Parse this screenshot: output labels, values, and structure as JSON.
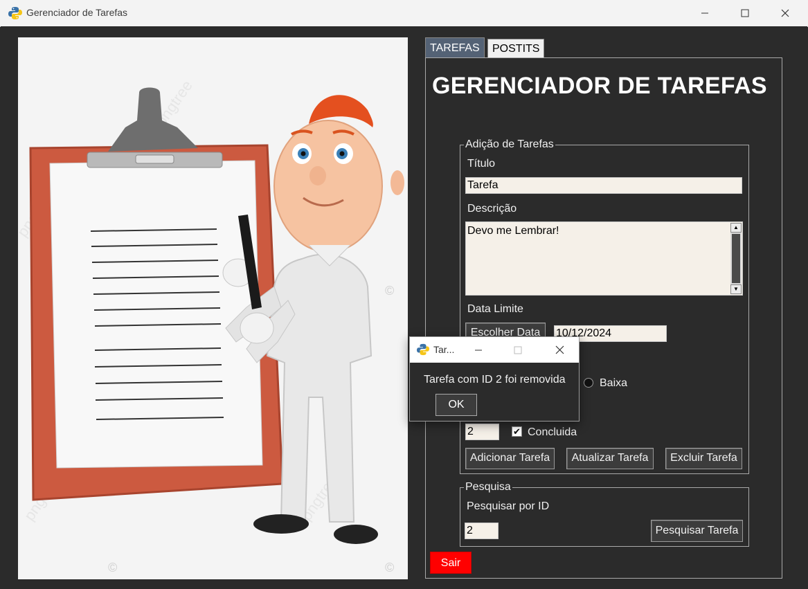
{
  "window": {
    "title": "Gerenciador de Tarefas"
  },
  "tabs": [
    {
      "label": "TAREFAS",
      "active": true
    },
    {
      "label": "POSTITS",
      "active": false
    }
  ],
  "heading": "GERENCIADOR DE TAREFAS",
  "add_group": {
    "legend": "Adição de Tarefas",
    "title_label": "Título",
    "title_value": "Tarefa",
    "desc_label": "Descrição",
    "desc_value": "Devo me Lembrar!",
    "deadline_label": "Data Limite",
    "choose_date_button": "Escolher Data",
    "date_value": "10/12/2024",
    "priority_low_label": "Baixa",
    "id_value": "2",
    "completed_label": "Concluida",
    "completed_checked": true,
    "add_button": "Adicionar Tarefa",
    "update_button": "Atualizar Tarefa",
    "delete_button": "Excluir Tarefa"
  },
  "search_group": {
    "legend": "Pesquisa",
    "id_label": "Pesquisar por ID",
    "id_value": "2",
    "search_button": "Pesquisar Tarefa"
  },
  "exit_button": "Sair",
  "dialog": {
    "title": "Tar...",
    "message": "Tarefa com ID 2 foi removida",
    "ok_button": "OK"
  },
  "illustration": {
    "watermark": "pngtree",
    "copyright_symbol": "©"
  },
  "colors": {
    "background": "#2b2b2b",
    "active_tab": "#546275",
    "exit_button": "#ff0000",
    "entry_bg": "#f5f0e8"
  }
}
